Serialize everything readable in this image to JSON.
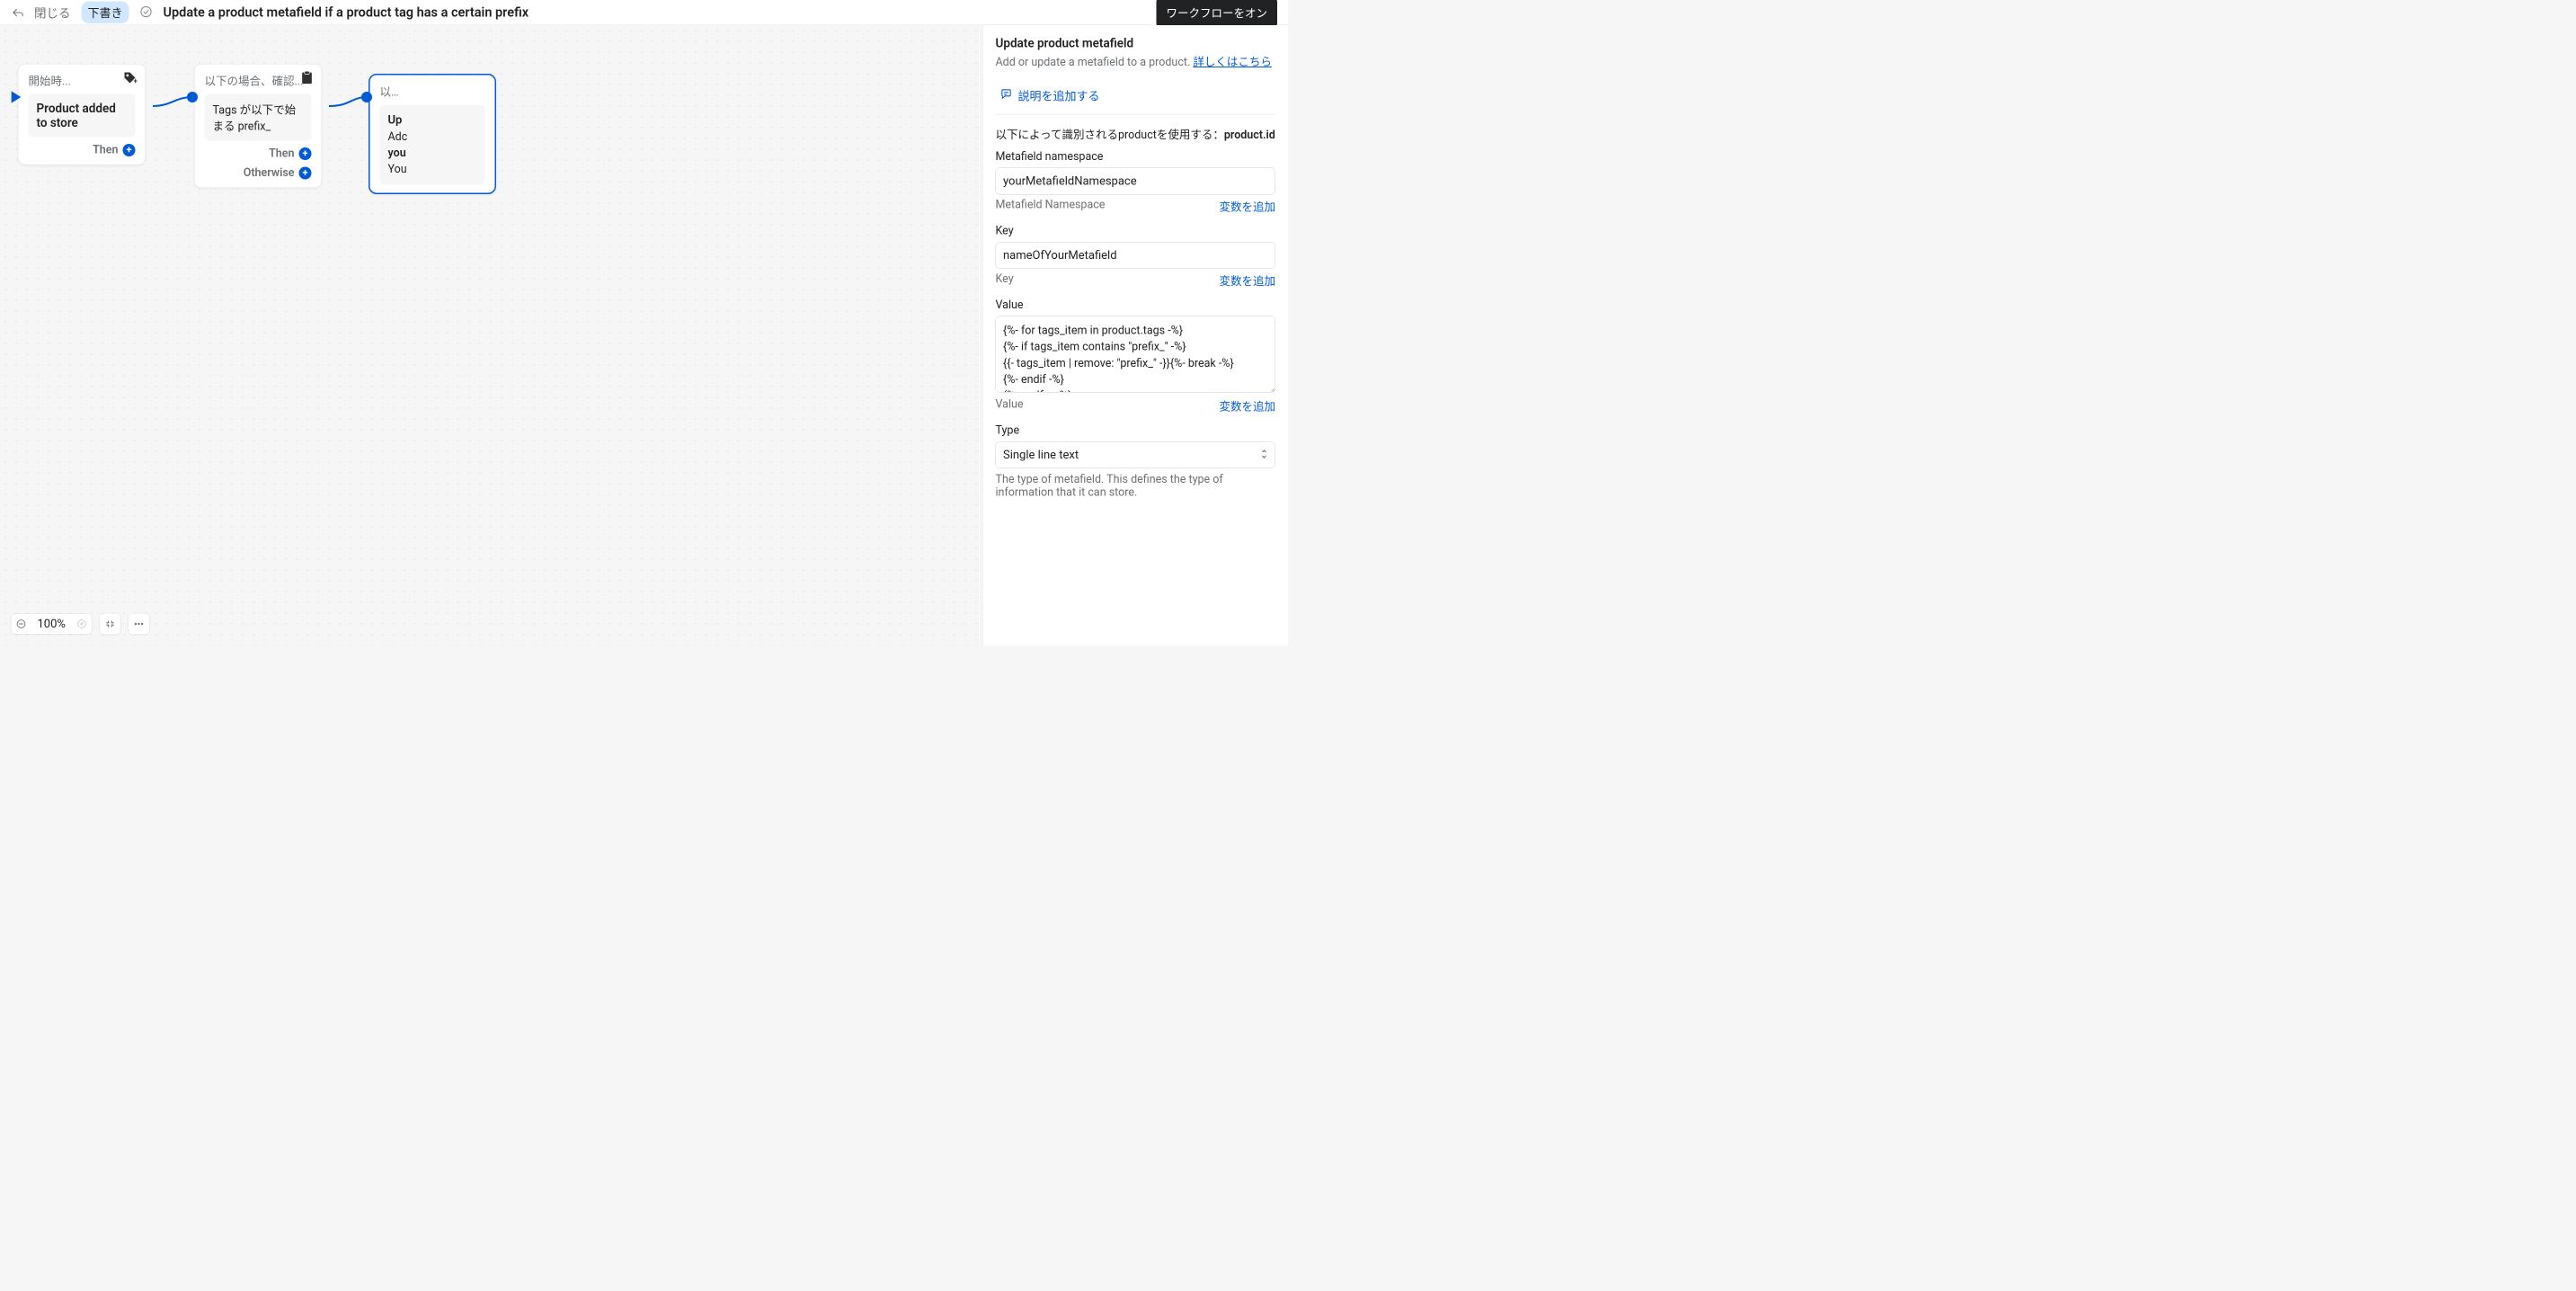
{
  "topbar": {
    "close_label": "閉じる",
    "draft_badge": "下書き",
    "title": "Update a product metafield if a product tag has a certain prefix",
    "workflow_on_btn": "ワークフローをオン"
  },
  "nodes": {
    "start": {
      "header": "開始時...",
      "body": "Product added to store",
      "then": "Then"
    },
    "condition": {
      "header": "以下の場合、確認...",
      "body": "Tags が以下で始まる prefix_",
      "then": "Then",
      "otherwise": "Otherwise"
    },
    "action": {
      "header": "以…",
      "title": "Up",
      "line2": "Adc",
      "line3": "you",
      "line4": "You"
    }
  },
  "panel": {
    "title": "Update product metafield",
    "subtitle": "Add or update a metafield to a product. ",
    "learn_more": "詳しくはこちら",
    "add_description": "説明を追加する",
    "identify_prefix": "以下によって識別されるproductを使用する：",
    "identify_value": "product.id",
    "fields": {
      "namespace": {
        "label": "Metafield namespace",
        "value": "yourMetafieldNamespace",
        "helper": "Metafield Namespace",
        "add_var": "変数を追加"
      },
      "key": {
        "label": "Key",
        "value": "nameOfYourMetafield",
        "helper": "Key",
        "add_var": "変数を追加"
      },
      "value": {
        "label": "Value",
        "value": "{%- for tags_item in product.tags -%}\n{%- if tags_item contains \"prefix_\" -%}\n{{- tags_item | remove: \"prefix_\" -}}{%- break -%}\n{%- endif -%}\n{%- endfor -%}",
        "helper": "Value",
        "add_var": "変数を追加"
      },
      "type": {
        "label": "Type",
        "value": "Single line text",
        "helper": "The type of metafield. This defines the type of information that it can store."
      }
    }
  },
  "toolbar": {
    "zoom": "100%"
  }
}
